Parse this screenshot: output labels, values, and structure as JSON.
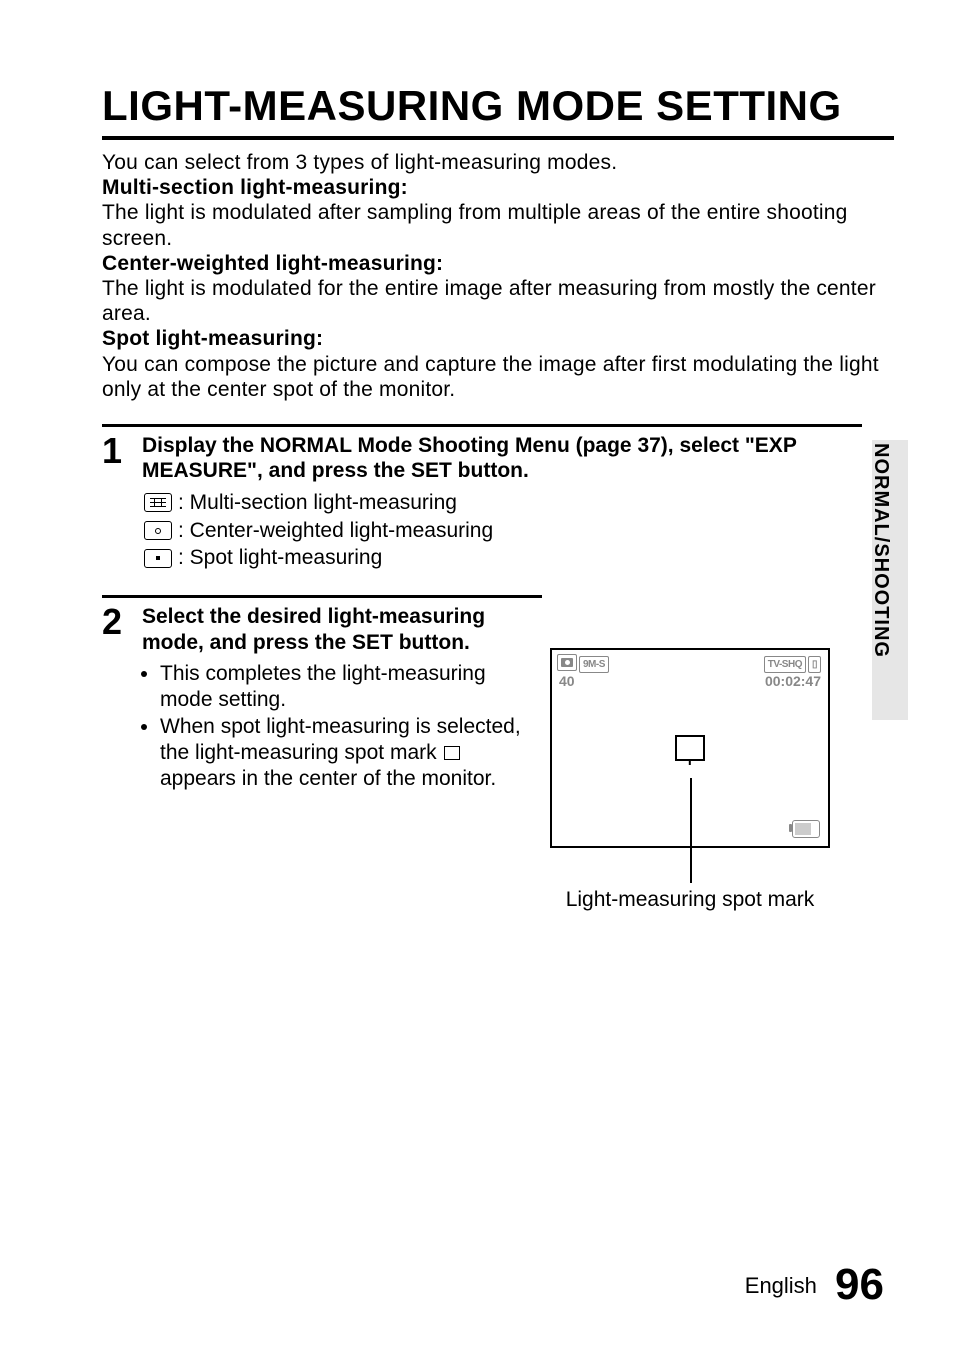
{
  "title": "LIGHT-MEASURING MODE SETTING",
  "intro_line": "You can select from 3 types of light-measuring modes.",
  "modes": {
    "multi": {
      "heading": "Multi-section light-measuring:",
      "desc": "The light is modulated after sampling from multiple areas of the entire shooting screen."
    },
    "center": {
      "heading": "Center-weighted light-measuring:",
      "desc": "The light is modulated for the entire image after measuring from mostly the center area."
    },
    "spot": {
      "heading": "Spot light-measuring:",
      "desc": "You can compose the picture and capture the image after first modulating the light only at the center spot of the monitor."
    }
  },
  "steps": {
    "s1": {
      "num": "1",
      "heading": "Display the NORMAL Mode Shooting Menu (page 37), select \"EXP MEASURE\", and press the SET button.",
      "icon_multi": "Multi-section light-measuring",
      "icon_center": "Center-weighted light-measuring",
      "icon_spot": "Spot light-measuring"
    },
    "s2": {
      "num": "2",
      "heading": "Select the desired light-measuring mode, and press the SET button.",
      "b1": "This completes the light-measuring mode setting.",
      "b2_a": "When spot light-measuring is selected, the light-measuring spot mark ",
      "b2_b": " appears in the center of the monitor."
    }
  },
  "lcd": {
    "res_label": "9M-S",
    "mode_badge": "TV-SHQ",
    "count": "40",
    "time": "00:02:47",
    "callout": "Light-measuring spot mark"
  },
  "side_tab": "NORMAL/SHOOTING",
  "footer": {
    "lang": "English",
    "page": "96"
  }
}
